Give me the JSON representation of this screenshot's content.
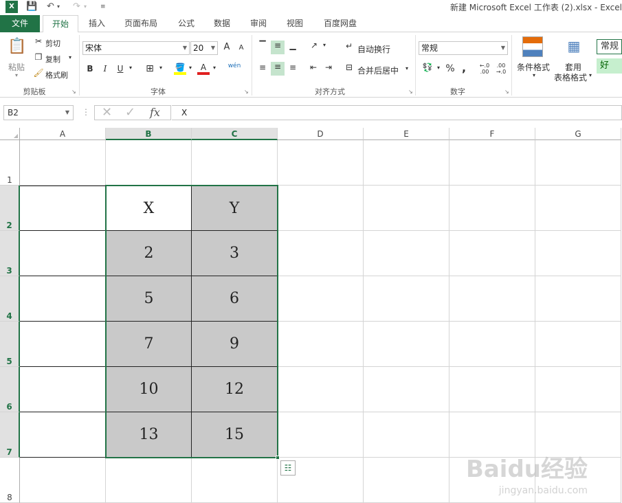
{
  "titlebar": {
    "title": "新建 Microsoft Excel 工作表 (2).xlsx - Excel",
    "app_icon": "excel-icon",
    "save_icon": "save-icon",
    "undo_icon": "undo-icon",
    "redo_icon": "redo-icon"
  },
  "tabs": {
    "file": "文件",
    "home": "开始",
    "insert": "插入",
    "layout": "页面布局",
    "formulas": "公式",
    "data": "数据",
    "review": "审阅",
    "view": "视图",
    "baidu": "百度网盘"
  },
  "ribbon": {
    "clipboard": {
      "paste": "粘贴",
      "cut": "剪切",
      "copy": "复制",
      "format_painter": "格式刷",
      "label": "剪贴板"
    },
    "font": {
      "name": "宋体",
      "size": "20",
      "grow": "A",
      "shrink": "A",
      "bold": "B",
      "italic": "I",
      "underline": "U",
      "font_color": "A",
      "phonetic": "wén",
      "label": "字体"
    },
    "alignment": {
      "wrap": "自动换行",
      "merge": "合并后居中",
      "label": "对齐方式"
    },
    "number": {
      "format": "常规",
      "percent": "%",
      "comma": ",",
      "label": "数字"
    },
    "styles": {
      "conditional": "条件格式",
      "table_format_1": "套用",
      "table_format_2": "表格格式",
      "style_normal": "常规",
      "style_good": "好"
    }
  },
  "formula_bar": {
    "name_box": "B2",
    "content": "X",
    "fx": "fx"
  },
  "sheet": {
    "columns": [
      "A",
      "B",
      "C",
      "D",
      "E",
      "F",
      "G"
    ],
    "rows": [
      "1",
      "2",
      "3",
      "4",
      "5",
      "6",
      "7",
      "8"
    ],
    "selected_columns": [
      "B",
      "C"
    ],
    "selected_rows": [
      "2",
      "3",
      "4",
      "5",
      "6",
      "7"
    ],
    "active_cell": "B2",
    "cells": {
      "B2": "X",
      "C2": "Y",
      "B3": "2",
      "C3": "3",
      "B4": "5",
      "C4": "6",
      "B5": "7",
      "C5": "9",
      "B6": "10",
      "C6": "12",
      "B7": "13",
      "C7": "15"
    }
  },
  "colors": {
    "accent": "#217346",
    "cell_fill": "#c9c9c9",
    "good_fill": "#c6efce"
  },
  "watermark": {
    "main": "Baidu经验",
    "sub": "jingyan.baidu.com"
  }
}
